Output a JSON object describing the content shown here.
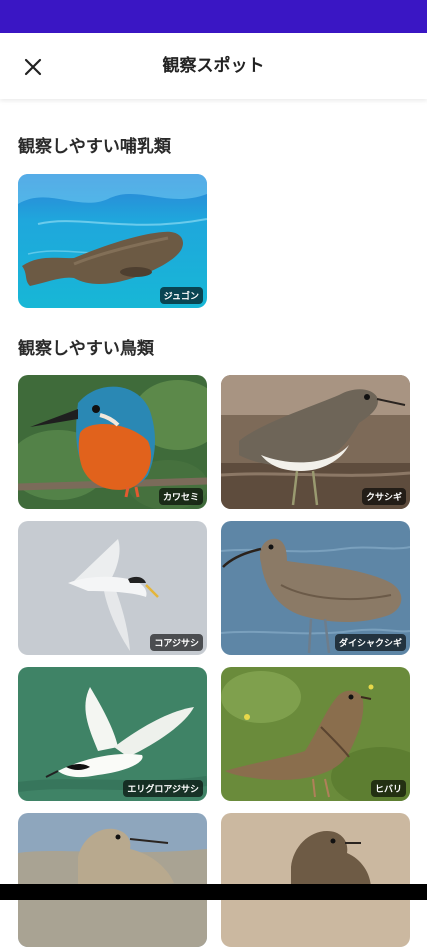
{
  "header": {
    "title": "観察スポット",
    "close_icon": "close-icon"
  },
  "sections": [
    {
      "title": "観察しやすい哺乳類",
      "items": [
        {
          "label": "ジュゴン"
        }
      ]
    },
    {
      "title": "観察しやすい鳥類",
      "items": [
        {
          "label": "カワセミ"
        },
        {
          "label": "クサシギ"
        },
        {
          "label": "コアジサシ"
        },
        {
          "label": "ダイシャクシギ"
        },
        {
          "label": "エリグロアジサシ"
        },
        {
          "label": "ヒバリ"
        },
        {
          "label": ""
        },
        {
          "label": ""
        }
      ]
    }
  ],
  "colors": {
    "status_bar": "#3a16c4",
    "header_bg": "#ffffff",
    "label_bg": "rgba(0,0,0,0.62)"
  }
}
